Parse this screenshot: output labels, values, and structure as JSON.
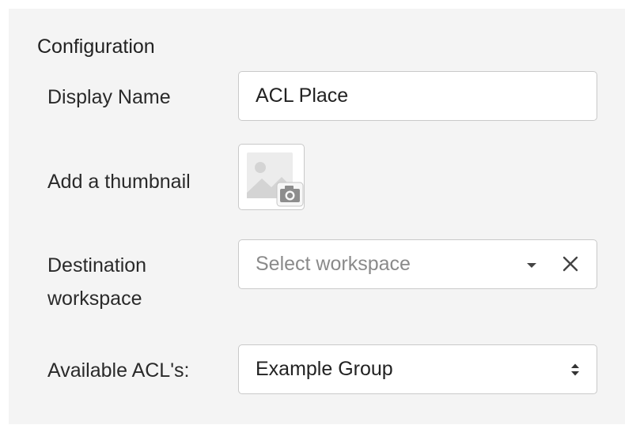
{
  "section": {
    "title": "Configuration"
  },
  "display_name": {
    "label": "Display Name",
    "value": "ACL Place"
  },
  "thumbnail": {
    "label": "Add a thumbnail",
    "icon": "image-placeholder-with-camera-icon"
  },
  "destination": {
    "label_line1": "Destination",
    "label_line2": "workspace",
    "placeholder": "Select workspace",
    "dropdown_icon": "caret-down-icon",
    "clear_icon": "close-icon"
  },
  "acls": {
    "label": "Available ACL's:",
    "selected": "Example Group",
    "icon": "sort-caret-icon"
  }
}
